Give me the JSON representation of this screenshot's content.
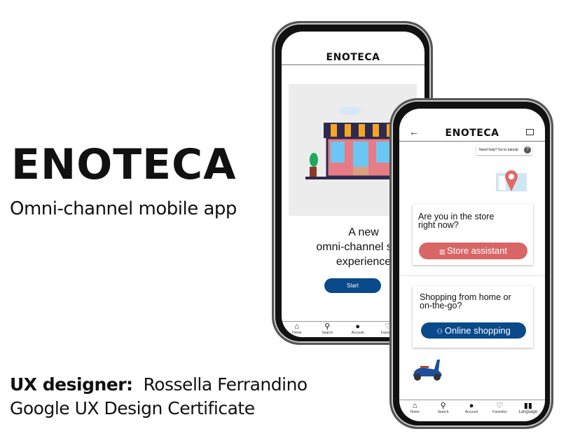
{
  "left": {
    "title": "ENOTECA",
    "subtitle": "Omni-channel mobile app",
    "designer_label": "UX designer:",
    "designer_name": "Rossella Ferrandino",
    "certificate": "Google UX Design Certificate"
  },
  "colors": {
    "primary": "#0b4a8a",
    "accent": "#d96666",
    "illustration_bg": "#ececec"
  },
  "phone1": {
    "header": "ENOTECA",
    "headline": [
      "A new",
      "omni-channel shop",
      "experience"
    ],
    "start_label": "Start",
    "nav": [
      {
        "label": "Home",
        "icon": "home-icon"
      },
      {
        "label": "Search",
        "icon": "search-icon"
      },
      {
        "label": "Account",
        "icon": "account-icon"
      },
      {
        "label": "Favorites",
        "icon": "heart-icon"
      }
    ]
  },
  "phone2": {
    "header": "ENOTECA",
    "help_label": "Need help? Go to tutorial",
    "card1": {
      "question": "Are you in the store right now?",
      "button": "Store assistant"
    },
    "card2": {
      "question": "Shopping from home or on-the-go?",
      "button": "Online shopping"
    },
    "nav": [
      {
        "label": "Home",
        "icon": "home-icon"
      },
      {
        "label": "Search",
        "icon": "search-icon"
      },
      {
        "label": "Account",
        "icon": "account-icon"
      },
      {
        "label": "Favorites",
        "icon": "heart-icon"
      },
      {
        "label": "Language",
        "icon": "language-icon"
      }
    ]
  }
}
